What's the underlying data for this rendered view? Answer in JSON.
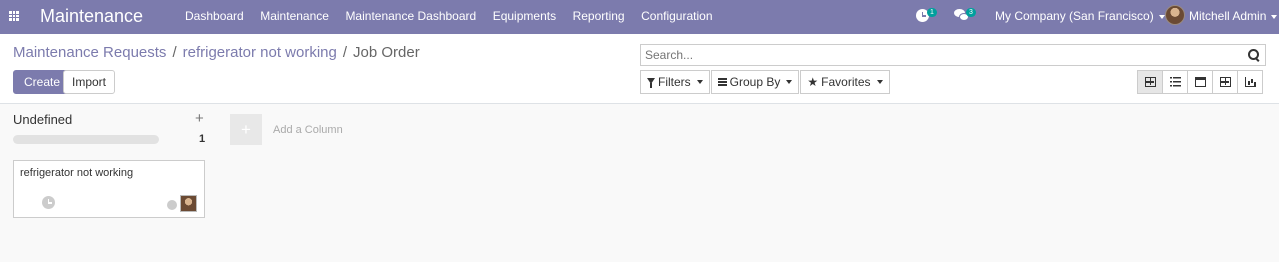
{
  "navbar": {
    "app_title": "Maintenance",
    "menu": [
      "Dashboard",
      "Maintenance",
      "Maintenance Dashboard",
      "Equipments",
      "Reporting",
      "Configuration"
    ],
    "activity_badge": "1",
    "message_badge": "3",
    "company": "My Company (San Francisco)",
    "user": "Mitchell Admin",
    "accent_color": "#7c7bad"
  },
  "breadcrumb": {
    "items": [
      "Maintenance Requests",
      "refrigerator not working"
    ],
    "current": "Job Order",
    "separator": "/"
  },
  "toolbar": {
    "create_label": "Create",
    "import_label": "Import"
  },
  "search": {
    "placeholder": "Search...",
    "value": ""
  },
  "filters": {
    "filters_label": "Filters",
    "group_by_label": "Group By",
    "favorites_label": "Favorites"
  },
  "views": {
    "active": "kanban",
    "icons": [
      "kanban-view-icon",
      "list-view-icon",
      "calendar-view-icon",
      "pivot-view-icon",
      "graph-view-icon"
    ]
  },
  "kanban": {
    "columns": [
      {
        "title": "Undefined",
        "count": "1",
        "cards": [
          {
            "title": "refrigerator not working"
          }
        ]
      }
    ],
    "add_column_label": "Add a Column"
  }
}
